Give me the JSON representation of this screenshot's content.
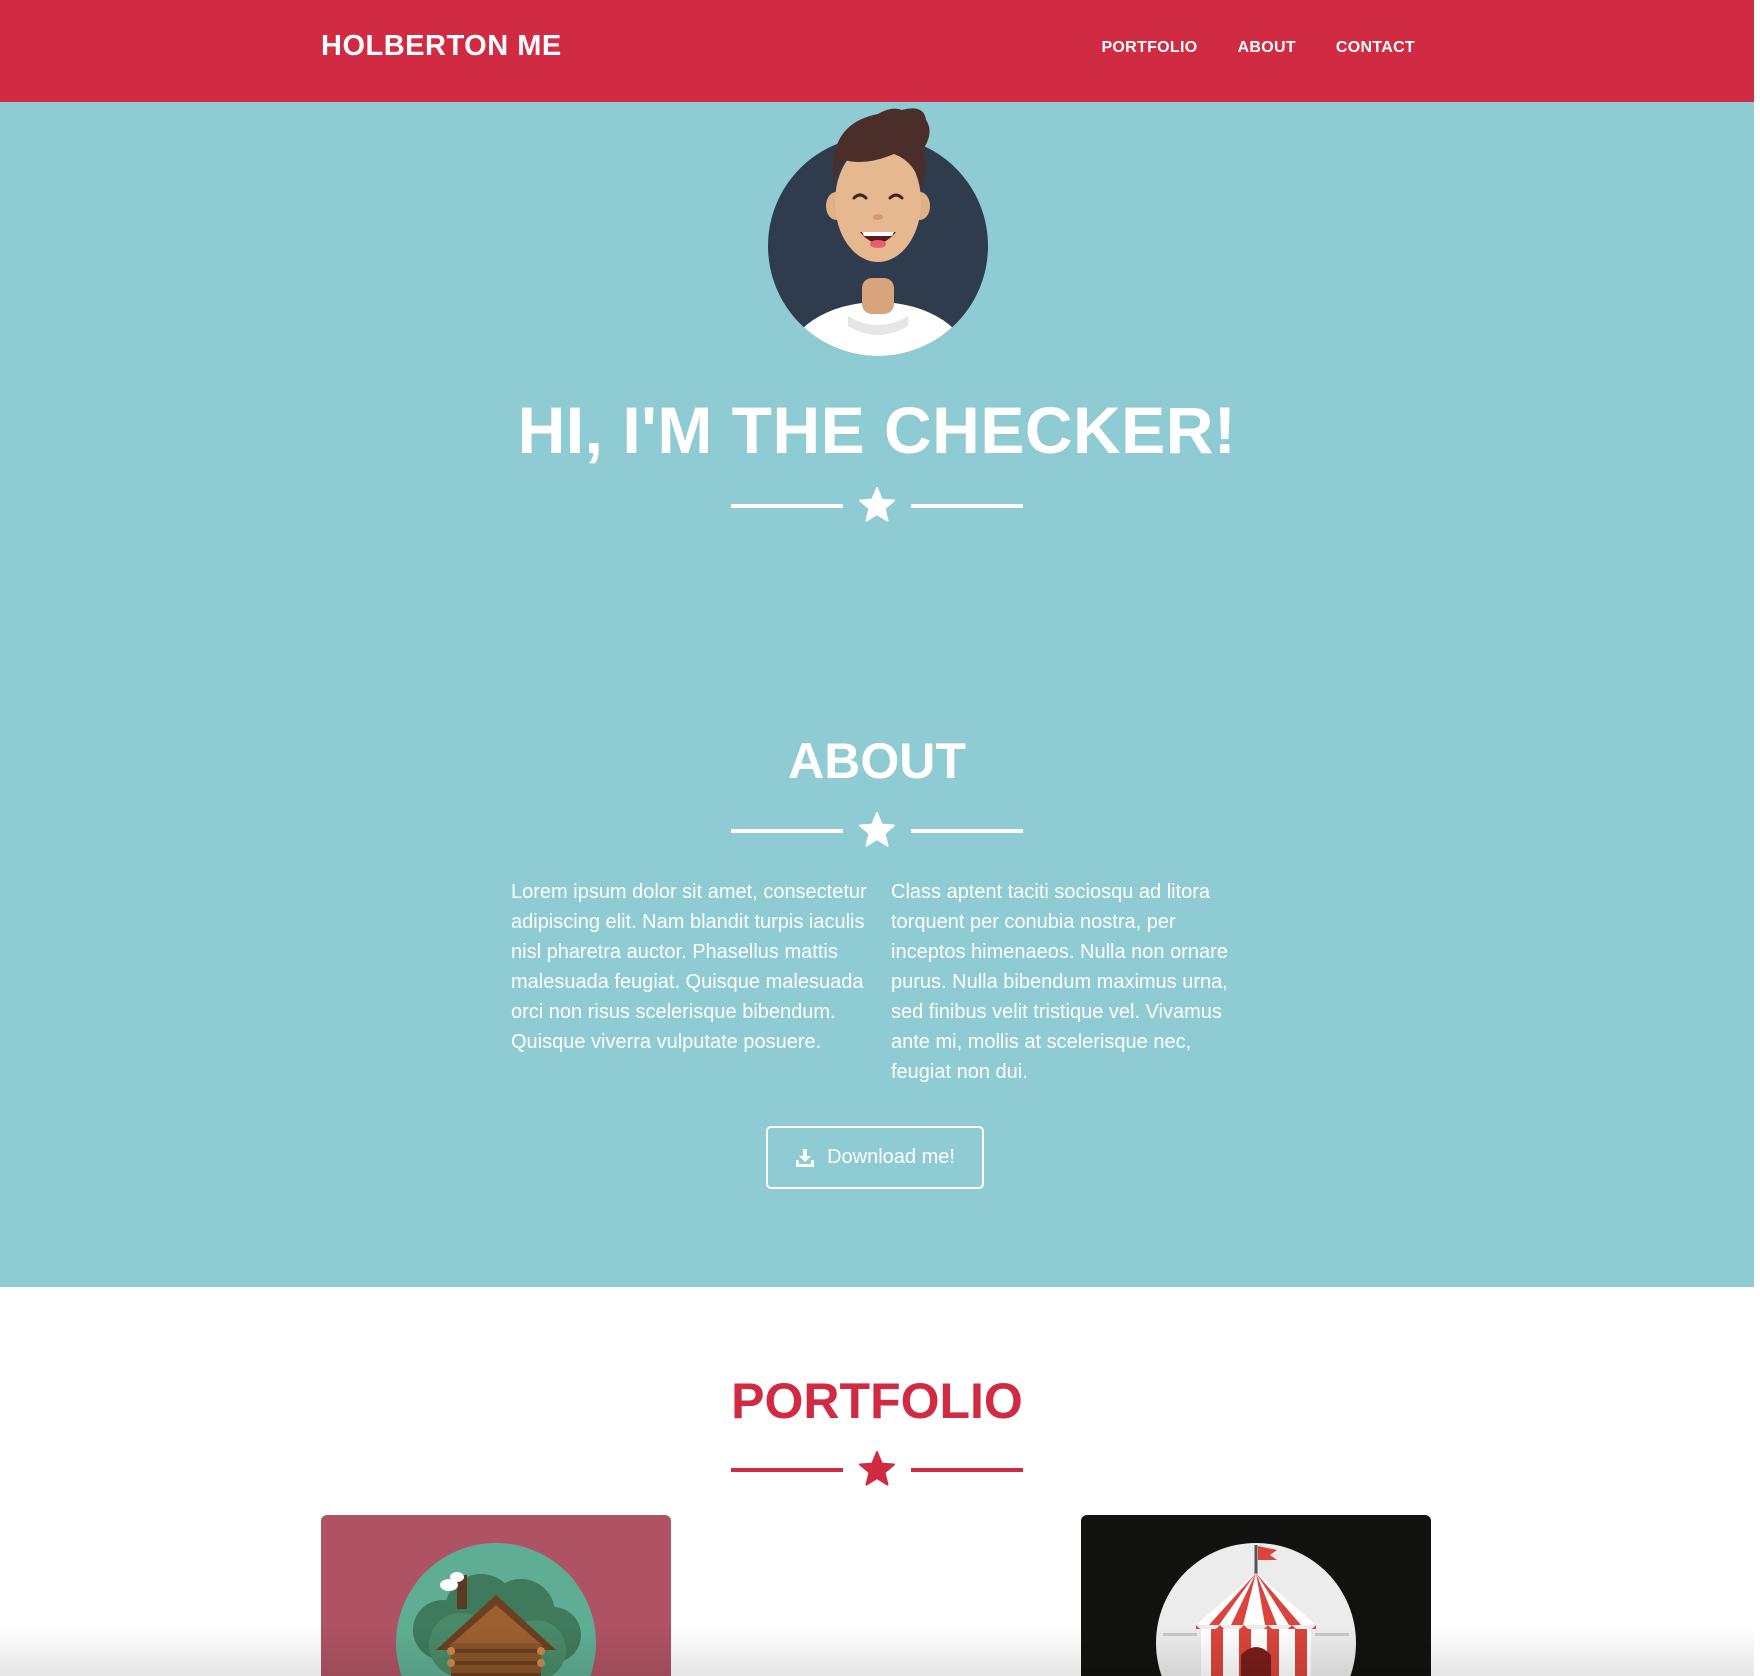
{
  "navbar": {
    "brand": "HOLBERTON ME",
    "links": [
      "PORTFOLIO",
      "ABOUT",
      "CONTACT"
    ],
    "background_color": "#d02b42"
  },
  "hero": {
    "title": "HI, I'M THE CHECKER!",
    "avatar_icon": "smiling-person-avatar",
    "background_color": "#8fcbd2"
  },
  "about": {
    "title": "ABOUT",
    "paragraph_left": "Lorem ipsum dolor sit amet, consectetur adipiscing elit. Nam blandit turpis iaculis nisl pharetra auctor. Phasellus mattis malesuada feugiat. Quisque malesuada orci non risus scelerisque bibendum. Quisque viverra vulputate posuere.",
    "paragraph_right": "Class aptent taciti sociosqu ad litora torquent per conubia nostra, per inceptos himenaeos. Nulla non ornare purus. Nulla bibendum maximus urna, sed finibus velit tristique vel. Vivamus ante mi, mollis at scelerisque nec, feugiat non dui.",
    "download_label": "Download me!",
    "download_icon": "download-icon"
  },
  "portfolio": {
    "title": "PORTFOLIO",
    "title_color": "#d02b42",
    "items": [
      {
        "icon": "log-cabin-icon",
        "background_color": "#af5364"
      },
      {
        "icon": "circus-tent-icon",
        "background_color": "#121210"
      }
    ]
  },
  "divider_icon": "star-icon"
}
